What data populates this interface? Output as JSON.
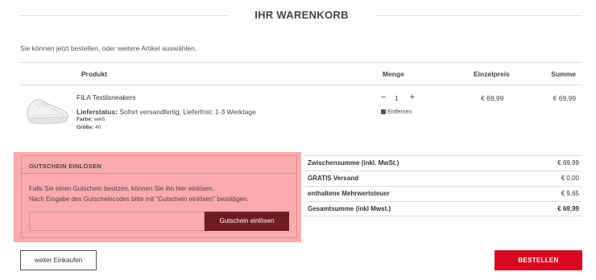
{
  "page": {
    "title": "IHR WARENKORB",
    "intro": "Sie können jetzt bestellen, oder weitere Artikel auswählen."
  },
  "table": {
    "col_product": "Produkt",
    "col_quantity": "Menge",
    "col_unit_price": "Einzelpreis",
    "col_total": "Summe"
  },
  "item": {
    "image_icon": "sneaker-image",
    "name": "FILA Textilsneakers",
    "status_label": "Lieferstatus:",
    "status_value": "Sofort versandfertig, Lieferfrist: 1-3 Werktage",
    "color_label": "Farbe:",
    "color_value": "weiß",
    "size_label": "Größe:",
    "size_value": "40",
    "quantity": "1",
    "minus": "−",
    "plus": "+",
    "remove_label": "Entfernen",
    "unit_price": "€ 69,99",
    "total_price": "€ 69,99"
  },
  "coupon": {
    "title": "GUTSCHEIN EINLÖSEN",
    "text_line1": "Falls Sie einen Gutschein besitzen, können Sie ihn hier einlösen.",
    "text_line2": "Nach Eingabe des Gutscheincodes bitte mit \"Gutschein einlösen\" bestätigen.",
    "input_value": "",
    "input_placeholder": "",
    "button_label": "Gutschein einlösen"
  },
  "totals": [
    {
      "label": "Zwischensumme (inkl. MwSt.)",
      "value": "€ 69,99"
    },
    {
      "label": "GRATIS Versand",
      "value": "€ 0,00"
    },
    {
      "label": "enthaltene Mehrwertsteuer",
      "value": "€ 9,65"
    },
    {
      "label": "Gesamtsumme (inkl Mwst.)",
      "value": "€ 69,99"
    }
  ],
  "actions": {
    "continue_label": "weiter Einkaufen",
    "order_label": "BESTELLEN"
  },
  "colors": {
    "accent": "#d7081e",
    "coupon_bg": "#fcaaaa",
    "coupon_button": "#6e1c20"
  }
}
